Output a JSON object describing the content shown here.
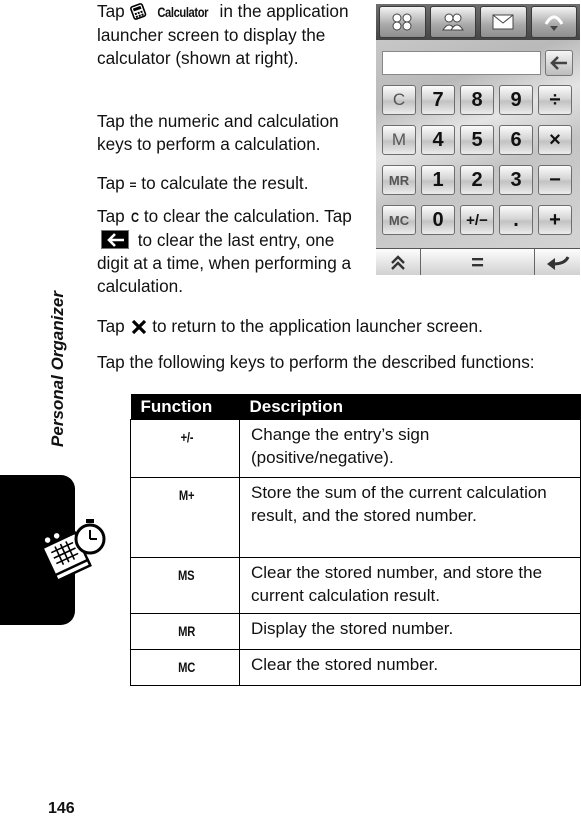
{
  "section": {
    "title": "Personal Organizer",
    "icon": "organizer-calendar-clock-icon"
  },
  "page_number": "146",
  "paragraphs": {
    "p1": {
      "prefix": "Tap ",
      "icon": "calculator-icon",
      "keyword": "Calculator",
      "suffix": " in the application launcher screen to display the calculator (shown at right)."
    },
    "p2": "Tap the numeric and calculation keys to perform a calculation.",
    "p3": {
      "prefix": "Tap ",
      "key": "=",
      "suffix": " to calculate the result."
    },
    "p4": {
      "prefix": "Tap ",
      "key": "C",
      "mid": " to clear the calculation. Tap ",
      "icon": "backspace-arrow-icon",
      "suffix": " to clear the last entry, one digit at a time, when performing a calculation."
    },
    "p5": {
      "prefix": "Tap ",
      "icon": "close-x-icon",
      "suffix": " to return to the application launcher screen."
    },
    "p6": "Tap the following keys to perform the described functions:"
  },
  "calculator": {
    "top_buttons": [
      "apps-grid-icon",
      "contacts-icon",
      "message-envelope-icon",
      "up-arrow-icon"
    ],
    "display_value": "",
    "keys": [
      [
        "C",
        "7",
        "8",
        "9",
        "÷"
      ],
      [
        "M",
        "4",
        "5",
        "6",
        "×"
      ],
      [
        "MR",
        "1",
        "2",
        "3",
        "−"
      ],
      [
        "MC",
        "0",
        "+/−",
        ".",
        "+"
      ]
    ],
    "bottom_buttons": {
      "left": "double-chevron-up-icon",
      "center": "=",
      "right": "enter-return-icon"
    }
  },
  "table": {
    "headers": [
      "Function",
      "Description"
    ],
    "rows": [
      {
        "function": "+/-",
        "description": "Change the entry’s sign (positive/negative)."
      },
      {
        "function": "M+",
        "description": "Store the sum of the current calculation result, and the stored number."
      },
      {
        "function": "MS",
        "description": "Clear the stored number, and store the current calculation result."
      },
      {
        "function": "MR",
        "description": "Display the stored number."
      },
      {
        "function": "MC",
        "description": "Clear the stored number."
      }
    ]
  }
}
